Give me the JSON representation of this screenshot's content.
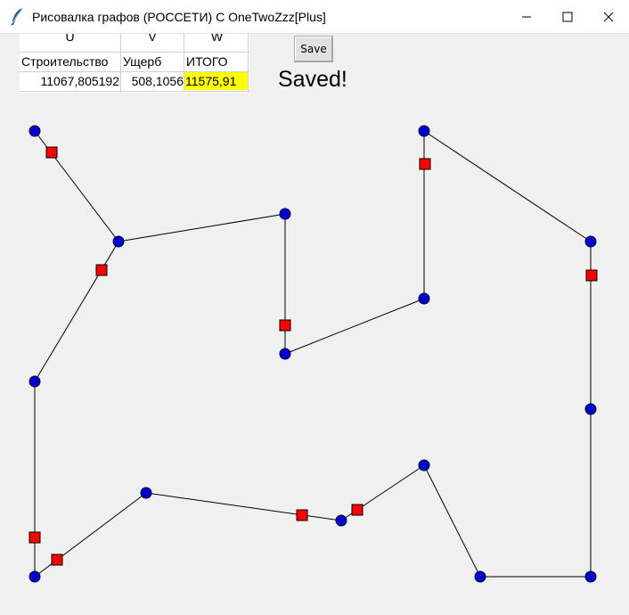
{
  "window": {
    "title": "Рисовалка графов (РОССЕТИ) С OneTwoZzz[Plus]",
    "icon": "feather-icon",
    "controls": [
      "minimize-icon",
      "maximize-icon",
      "close-icon"
    ]
  },
  "table": {
    "column_letters": [
      "U",
      "V",
      "W"
    ],
    "headers": [
      "Строительство",
      "Ущерб",
      "ИТОГО"
    ],
    "values": [
      "11067,805192",
      "508,1056",
      "11575,91"
    ],
    "highlight_color": "#ffff00"
  },
  "save_button": {
    "label": "Save"
  },
  "status_message": "Saved!",
  "graph": {
    "node_color": "#0000cc",
    "marker_color": "#ff0000",
    "edge_color": "#000000",
    "node_icon": "blue-circle",
    "marker_icon": "red-square"
  }
}
